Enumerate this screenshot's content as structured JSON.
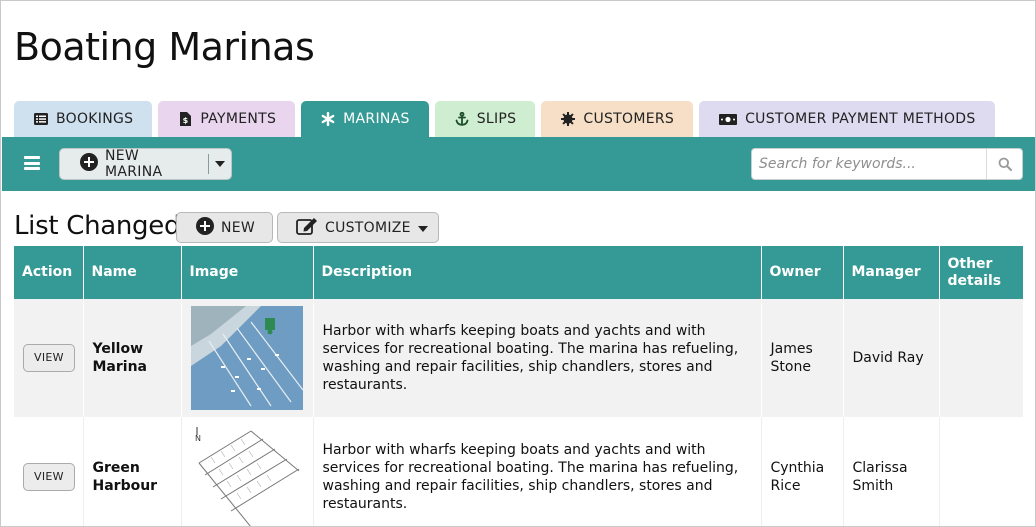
{
  "app": {
    "title": "Boating Marinas"
  },
  "tabs": [
    {
      "label": "BOOKINGS",
      "icon": "list-icon",
      "color": "#cfe0ee"
    },
    {
      "label": "PAYMENTS",
      "icon": "invoice-icon",
      "color": "#ead5ee"
    },
    {
      "label": "MARINAS",
      "icon": "asterisk-icon",
      "color": "#359a95",
      "active": true
    },
    {
      "label": "SLIPS",
      "icon": "anchor-icon",
      "color": "#cfedd0"
    },
    {
      "label": "CUSTOMERS",
      "icon": "gear-icon",
      "color": "#f6dfc6"
    },
    {
      "label": "CUSTOMER PAYMENT METHODS",
      "icon": "money-icon",
      "color": "#dedbf1"
    }
  ],
  "toolbar": {
    "new_label": "NEW MARINA",
    "search_placeholder": "Search for keywords..."
  },
  "list": {
    "title": "List Changed",
    "new_label": "NEW",
    "customize_label": "CUSTOMIZE"
  },
  "table": {
    "headers": [
      "Action",
      "Name",
      "Image",
      "Description",
      "Owner",
      "Manager",
      "Other details"
    ],
    "rows": [
      {
        "action": "VIEW",
        "name": "Yellow Marina",
        "description": "Harbor with wharfs keeping boats and yachts and with services for recreational boating. The marina has refueling, washing and repair facilities, ship chandlers, stores and restaurants.",
        "owner": "James Stone",
        "manager": "David Ray",
        "other_details": ""
      },
      {
        "action": "VIEW",
        "name": "Green Harbour",
        "description": "Harbor with wharfs keeping boats and yachts and with services for recreational boating. The marina has refueling, washing and repair facilities, ship chandlers, stores and restaurants.",
        "owner": "Cynthia Rice",
        "manager": "Clarissa Smith",
        "other_details": ""
      }
    ]
  },
  "colors": {
    "teal": "#359a95",
    "tab_active_text": "#ffffff"
  }
}
